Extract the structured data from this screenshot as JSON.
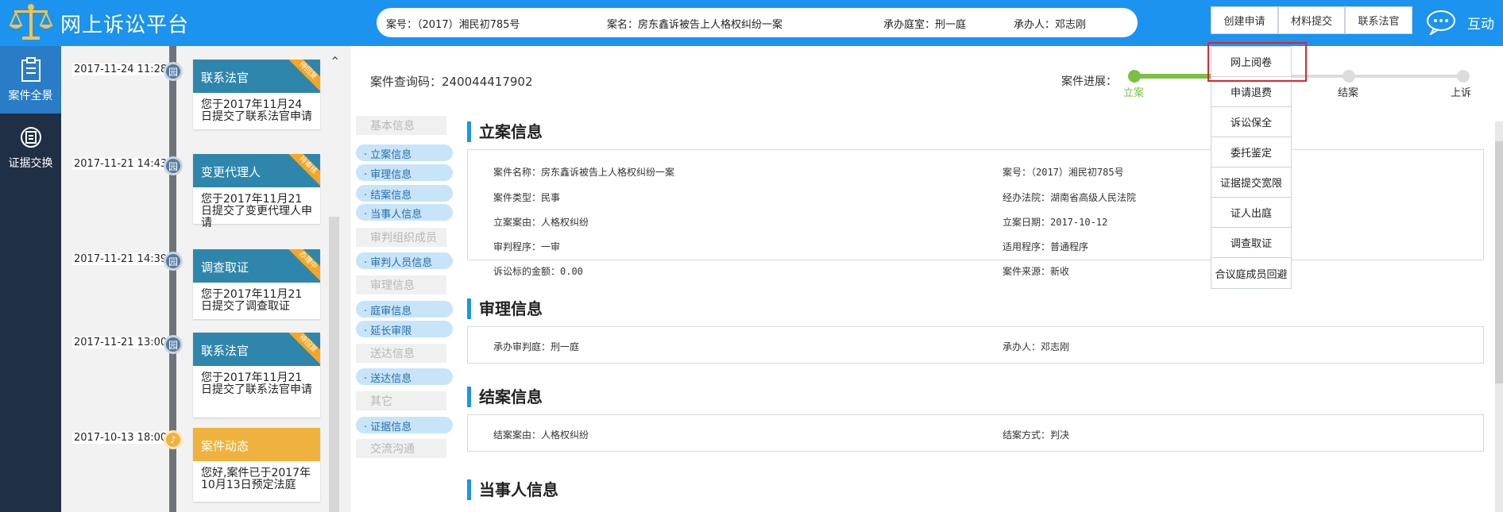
{
  "header": {
    "app_title": "网上诉讼平台",
    "case_no": "案号：（2017）湘民初785号",
    "case_name": "案名：房东鑫诉被告上人格权纠纷一案",
    "court_room": "承办庭室：刑一庭",
    "handler": "承办人：邓志刚",
    "btn_create": "创建申请",
    "btn_materials": "材料提交",
    "btn_contact": "联系法官",
    "chat_label": "互动"
  },
  "leftnav": {
    "items": [
      {
        "label": "案件全景",
        "icon": "clipboard-icon"
      },
      {
        "label": "证据交换",
        "icon": "exchange-icon"
      }
    ]
  },
  "timeline": {
    "events": [
      {
        "date": "2017-11-24 11:28",
        "title": "联系法官",
        "badge": "待回复",
        "body": "您于2017年11月24日提交了联系法官申请",
        "icon": "园"
      },
      {
        "date": "2017-11-21 14:43",
        "title": "变更代理人",
        "badge": "待审核",
        "body": "您于2017年11月21日提交了变更代理人申请",
        "icon": "园"
      },
      {
        "date": "2017-11-21 14:39",
        "title": "调查取证",
        "badge": "办理中",
        "body": "您于2017年11月21日提交了调查取证",
        "icon": "园"
      },
      {
        "date": "2017-11-21 13:00",
        "title": "联系法官",
        "badge": "待回复",
        "body": "您于2017年11月21日提交了联系法官申请",
        "icon": "园"
      },
      {
        "date": "2017-10-13 18:00",
        "title": "案件动态",
        "badge": "",
        "body": "您好,案件已于2017年10月13日预定法庭",
        "icon": "speaker-icon"
      }
    ]
  },
  "main": {
    "query_code": "案件查询码：240044417902",
    "progress_label": "案件进展：",
    "progress_steps": [
      "立案",
      "结案",
      "上诉"
    ],
    "progress_done_fraction": 0.26,
    "secnav": {
      "g1": "基本信息",
      "l1": "· 立案信息",
      "l2": "· 审理信息",
      "l3": "· 结案信息",
      "l4": "· 当事人信息",
      "g2": "审判组织成员",
      "l5": "· 审判人员信息",
      "g3": "审理信息",
      "l6": "· 庭审信息",
      "l7": "· 延长审限",
      "g4": "送达信息",
      "l8": "· 送达信息",
      "g5": "其它",
      "l9": "· 证据信息",
      "g6": "交流沟通"
    },
    "sections": {
      "filing_title": "立案信息",
      "filing": {
        "case_name": "案件名称：房东鑫诉被告上人格权纠纷一案",
        "case_no": "案号：（2017）湘民初785号",
        "case_type": "案件类型：民事",
        "court": "经办法院：湖南省高级人民法院",
        "cause": "立案案由：人格权纠纷",
        "date": "立案日期：2017-10-12",
        "procedure": "审判程序：一审",
        "applicable": "适用程序：普通程序",
        "amount": "诉讼标的金额：0.00",
        "source": "案件来源：新收"
      },
      "trial_title": "审理信息",
      "trial": {
        "court_room": "承办审判庭：刑一庭",
        "handler": "承办人：邓志刚"
      },
      "close_title": "结案信息",
      "close": {
        "cause": "结案案由：人格权纠纷",
        "method": "结案方式：判决"
      },
      "party_title": "当事人信息"
    }
  },
  "dropdown": {
    "items": [
      "网上阅卷",
      "申请退费",
      "诉讼保全",
      "委托鉴定",
      "证据提交宽限",
      "证人出庭",
      "调查取证",
      "合议庭成员回避"
    ]
  },
  "colors": {
    "header_blue": "#1c93ee",
    "nav_dark": "#1f2f45",
    "timeline_teal": "#2f86ac",
    "accent_orange": "#f0b23e",
    "progress_green": "#7ac143",
    "highlight_red": "#e0242a"
  }
}
